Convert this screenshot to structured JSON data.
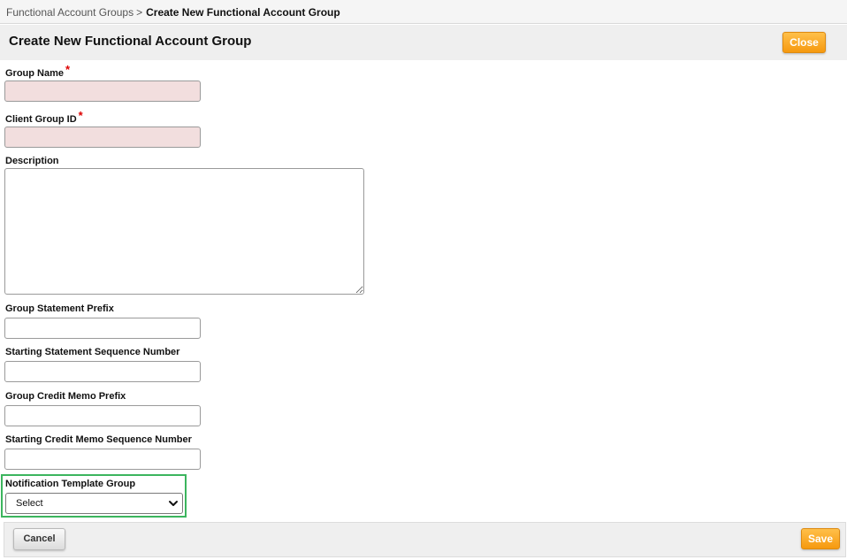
{
  "breadcrumb": {
    "parent": "Functional Account Groups",
    "separator": ">",
    "current": "Create New Functional Account Group"
  },
  "header": {
    "title": "Create New Functional Account Group",
    "close_label": "Close"
  },
  "form": {
    "group_name": {
      "label": "Group Name",
      "required_marker": "*",
      "value": ""
    },
    "client_group_id": {
      "label": "Client Group ID",
      "required_marker": "*",
      "value": ""
    },
    "description": {
      "label": "Description",
      "value": ""
    },
    "group_statement_prefix": {
      "label": "Group Statement Prefix",
      "value": ""
    },
    "starting_statement_sequence_number": {
      "label": "Starting Statement Sequence Number",
      "value": ""
    },
    "group_credit_memo_prefix": {
      "label": "Group Credit Memo Prefix",
      "value": ""
    },
    "starting_credit_memo_sequence_number": {
      "label": "Starting Credit Memo Sequence Number",
      "value": ""
    },
    "notification_template_group": {
      "label": "Notification Template Group",
      "selected": "Select"
    }
  },
  "footer": {
    "cancel_label": "Cancel",
    "save_label": "Save"
  },
  "colors": {
    "accent_orange": "#f6990f",
    "required_field_bg": "#f2dede",
    "highlight_border": "#3cb55e",
    "required_marker": "#dd0000"
  },
  "icons": {
    "select_dropdown": "chevron-down-icon",
    "textarea_resize": "resize-grip-icon"
  }
}
